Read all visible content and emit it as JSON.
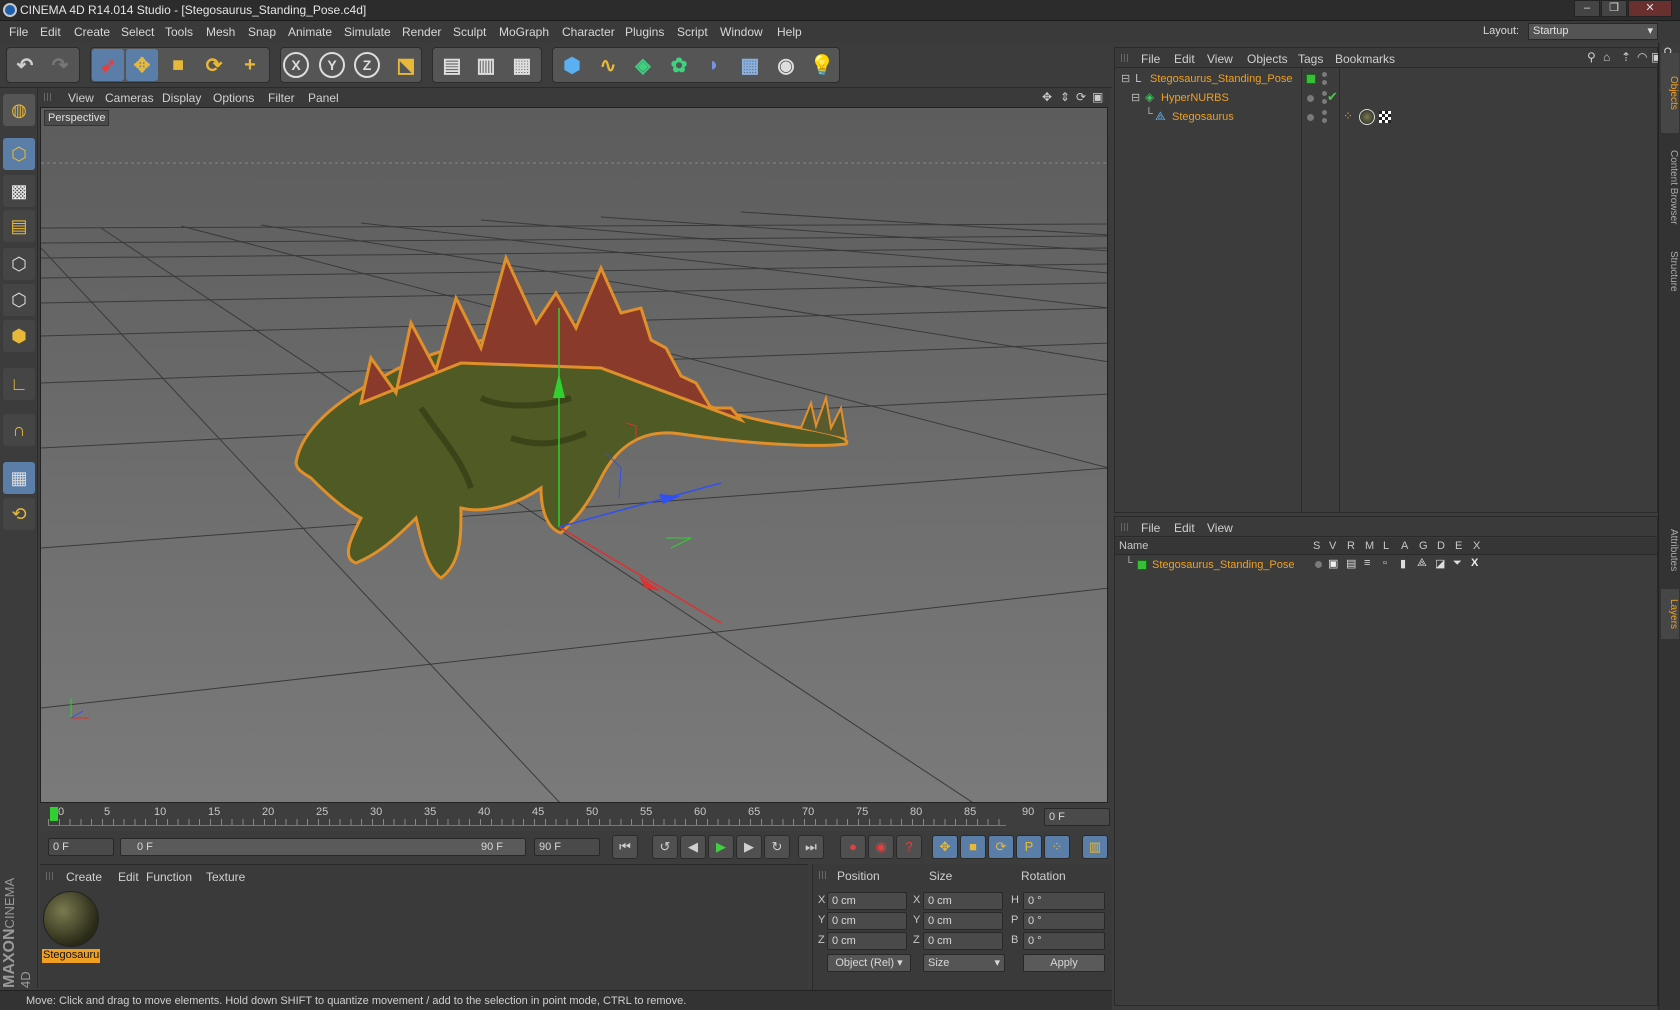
{
  "window": {
    "title": "CINEMA 4D R14.014 Studio - [Stegosaurus_Standing_Pose.c4d]",
    "minimize": "–",
    "restore": "❐",
    "close": "✕"
  },
  "menubar": {
    "items": [
      "File",
      "Edit",
      "Create",
      "Select",
      "Tools",
      "Mesh",
      "Snap",
      "Animate",
      "Simulate",
      "Render",
      "Sculpt",
      "MoGraph",
      "Character",
      "Plugins",
      "Script",
      "Window",
      "Help"
    ],
    "layout_label": "Layout:",
    "layout_value": "Startup"
  },
  "toolbar": {
    "icons": [
      "undo-icon",
      "redo-icon",
      "select-icon",
      "move-icon",
      "scale-icon",
      "rotate-icon",
      "last-tool-icon",
      "x-axis-icon",
      "y-axis-icon",
      "z-axis-icon",
      "coordinate-system-icon",
      "render-view-icon",
      "render-picture-icon",
      "render-settings-icon",
      "cube-icon",
      "spline-icon",
      "nurbs-icon",
      "array-icon",
      "deformer-icon",
      "floor-icon",
      "camera-icon",
      "light-icon"
    ],
    "axis_x": "X",
    "axis_y": "Y",
    "axis_z": "Z"
  },
  "viewport": {
    "menu": [
      "View",
      "Cameras",
      "Display",
      "Options",
      "Filter",
      "Panel"
    ],
    "label": "Perspective"
  },
  "timeline": {
    "ticks": [
      "0",
      "5",
      "10",
      "15",
      "20",
      "25",
      "30",
      "35",
      "40",
      "45",
      "50",
      "55",
      "60",
      "65",
      "70",
      "75",
      "80",
      "85",
      "90"
    ],
    "frame_field": "0 F"
  },
  "transport": {
    "start": "0 F",
    "range_start": "0 F",
    "range_end": "90 F",
    "end": "90 F"
  },
  "materials": {
    "menu": [
      "Create",
      "Edit",
      "Function",
      "Texture"
    ],
    "material_name": "Stegosaurus"
  },
  "coords": {
    "headers": [
      "Position",
      "Size",
      "Rotation"
    ],
    "rows": [
      {
        "axis": "X",
        "pos": "0 cm",
        "size_axis": "X",
        "size": "0 cm",
        "rot_axis": "H",
        "rot": "0 °"
      },
      {
        "axis": "Y",
        "pos": "0 cm",
        "size_axis": "Y",
        "size": "0 cm",
        "rot_axis": "P",
        "rot": "0 °"
      },
      {
        "axis": "Z",
        "pos": "0 cm",
        "size_axis": "Z",
        "size": "0 cm",
        "rot_axis": "B",
        "rot": "0 °"
      }
    ],
    "mode": "Object (Rel)",
    "size_mode": "Size",
    "apply": "Apply"
  },
  "objects": {
    "menu": [
      "File",
      "Edit",
      "View",
      "Objects",
      "Tags",
      "Bookmarks"
    ],
    "tree": [
      "Stegosaurus_Standing_Pose",
      "HyperNURBS",
      "Stegosaurus"
    ]
  },
  "layers": {
    "menu": [
      "File",
      "Edit",
      "View"
    ],
    "name_header": "Name",
    "flags": [
      "S",
      "V",
      "R",
      "M",
      "L",
      "A",
      "G",
      "D",
      "E",
      "X"
    ],
    "layer_name": "Stegosaurus_Standing_Pose"
  },
  "side_tabs": [
    "Objects",
    "Content Browser",
    "Structure",
    "Attributes",
    "Layers"
  ],
  "status": "Move: Click and drag to move elements. Hold down SHIFT to quantize movement / add to the selection in point mode, CTRL to remove.",
  "brand": {
    "maxon": "MAXON",
    "c4d": "CINEMA 4D"
  }
}
